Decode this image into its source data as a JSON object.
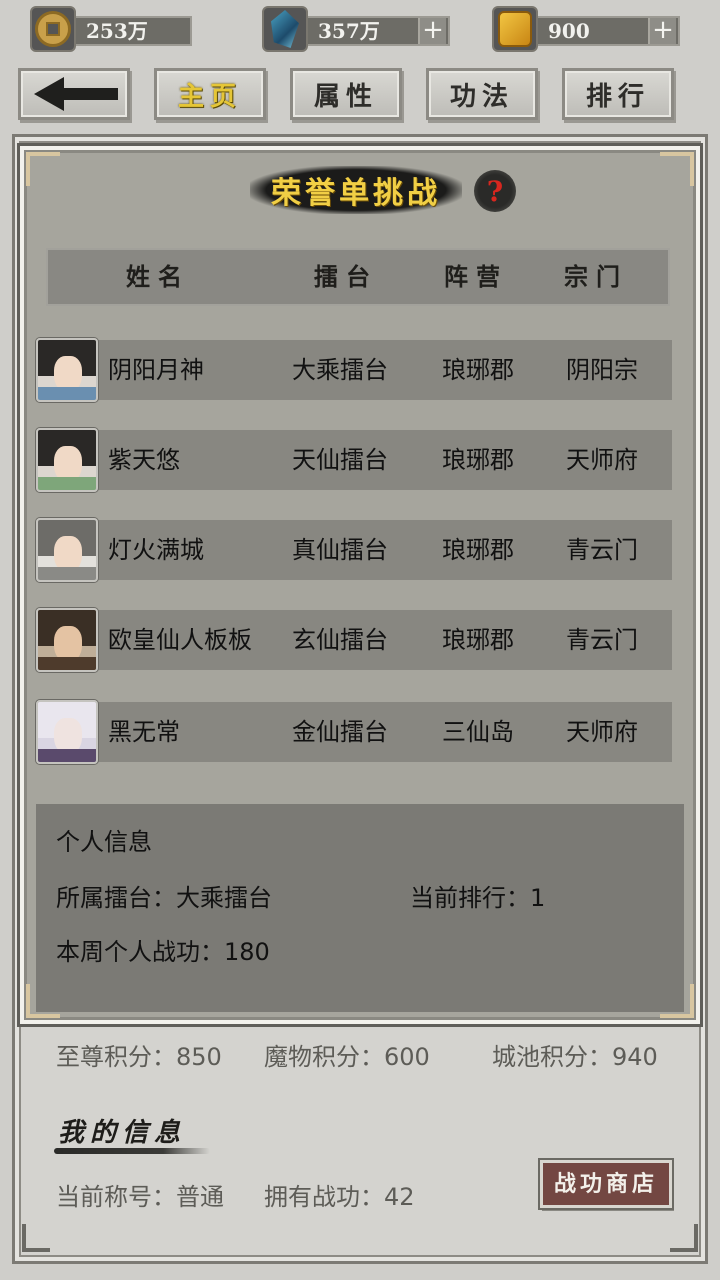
{
  "resources": [
    {
      "icon": "coin-icon",
      "value": "253万",
      "has_plus": false
    },
    {
      "icon": "crystal-icon",
      "value": "357万",
      "has_plus": true
    },
    {
      "icon": "gold-ingot-icon",
      "value": "900",
      "has_plus": true
    }
  ],
  "nav": {
    "home": "主页",
    "attributes": "属性",
    "skills": "功法",
    "ranking": "排行"
  },
  "title": "荣誉单挑战",
  "help_symbol": "?",
  "table": {
    "headers": [
      "姓名",
      "擂台",
      "阵营",
      "宗门"
    ],
    "rows": [
      {
        "name": "阴阳月神",
        "arena": "大乘擂台",
        "camp": "琅琊郡",
        "sect": "阴阳宗",
        "avatar": "female-avatar-icon"
      },
      {
        "name": "紫天悠",
        "arena": "天仙擂台",
        "camp": "琅琊郡",
        "sect": "天师府",
        "avatar": "female-avatar-icon"
      },
      {
        "name": "灯火满城",
        "arena": "真仙擂台",
        "camp": "琅琊郡",
        "sect": "青云门",
        "avatar": "elder-avatar-icon"
      },
      {
        "name": "欧皇仙人板板",
        "arena": "玄仙擂台",
        "camp": "琅琊郡",
        "sect": "青云门",
        "avatar": "male-avatar-icon"
      },
      {
        "name": "黑无常",
        "arena": "金仙擂台",
        "camp": "三仙岛",
        "sect": "天师府",
        "avatar": "masked-avatar-icon"
      }
    ]
  },
  "personal": {
    "title": "个人信息",
    "arena": "所属擂台：大乘擂台",
    "rank": "当前排行：1",
    "weekly_merit": "本周个人战功：180"
  },
  "scores": {
    "supreme": "至尊积分：850",
    "monster": "魔物积分：600",
    "city": "城池积分：940"
  },
  "my_info": {
    "title": "我的信息",
    "current_title": "当前称号：普通",
    "owned_merit": "拥有战功：42"
  },
  "shop_button": "战功商店"
}
